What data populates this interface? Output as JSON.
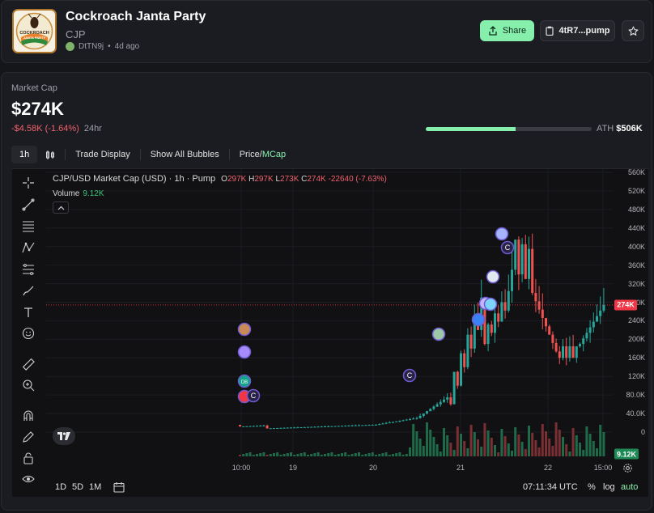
{
  "token": {
    "name": "Cockroach Janta Party",
    "ticker": "CJP",
    "creator": "DtTN9j",
    "age": "4d ago",
    "logo_text_top": "COCKROACH",
    "logo_text_bottom": "JANTA PARTY"
  },
  "actions": {
    "share_label": "Share",
    "contract_label": "4tR7...pump"
  },
  "market": {
    "label": "Market Cap",
    "value": "$274K",
    "change": "-$4.58K (-1.64%)",
    "period": "24hr",
    "ath_label": "ATH",
    "ath_value": "$506K",
    "ath_progress": 0.54
  },
  "toolbar": {
    "interval": "1h",
    "trade_display": "Trade Display",
    "show_bubbles": "Show All Bubbles",
    "price_label": "Price/",
    "mcap_label": "MCap"
  },
  "chart": {
    "title": "CJP/USD Market Cap (USD) · 1h · Pump",
    "ohlc": [
      {
        "k": "O",
        "v": "297K"
      },
      {
        "k": "H",
        "v": "297K"
      },
      {
        "k": "L",
        "v": "273K"
      },
      {
        "k": "C",
        "v": "274K"
      },
      {
        "k": "",
        "v": "-22640 (-7.63%)"
      }
    ],
    "volume_label": "Volume",
    "volume_value": "9.12K",
    "current_tag": "274K",
    "volume_tag": "9.12K",
    "time_readout": "07:11:34 UTC",
    "ranges": [
      "1D",
      "5D",
      "1M"
    ],
    "pct": "%",
    "log": "log",
    "auto": "auto",
    "colors": {
      "up": "#26a69a",
      "down": "#ef5350",
      "vol_up": "#1f6b49",
      "vol_down": "#7a2f33"
    }
  },
  "chart_data": {
    "type": "candlestick",
    "y_ticks": [
      "560K",
      "520K",
      "480K",
      "440K",
      "400K",
      "360K",
      "320K",
      "280K",
      "240K",
      "200K",
      "160K",
      "120K",
      "80.0K",
      "40.0K",
      "0"
    ],
    "x_ticks": [
      "10:00",
      "19",
      "20",
      "21",
      "22",
      "15:00"
    ],
    "ylim": [
      0,
      560000
    ],
    "last_close": 274000,
    "ath": 506000
  }
}
